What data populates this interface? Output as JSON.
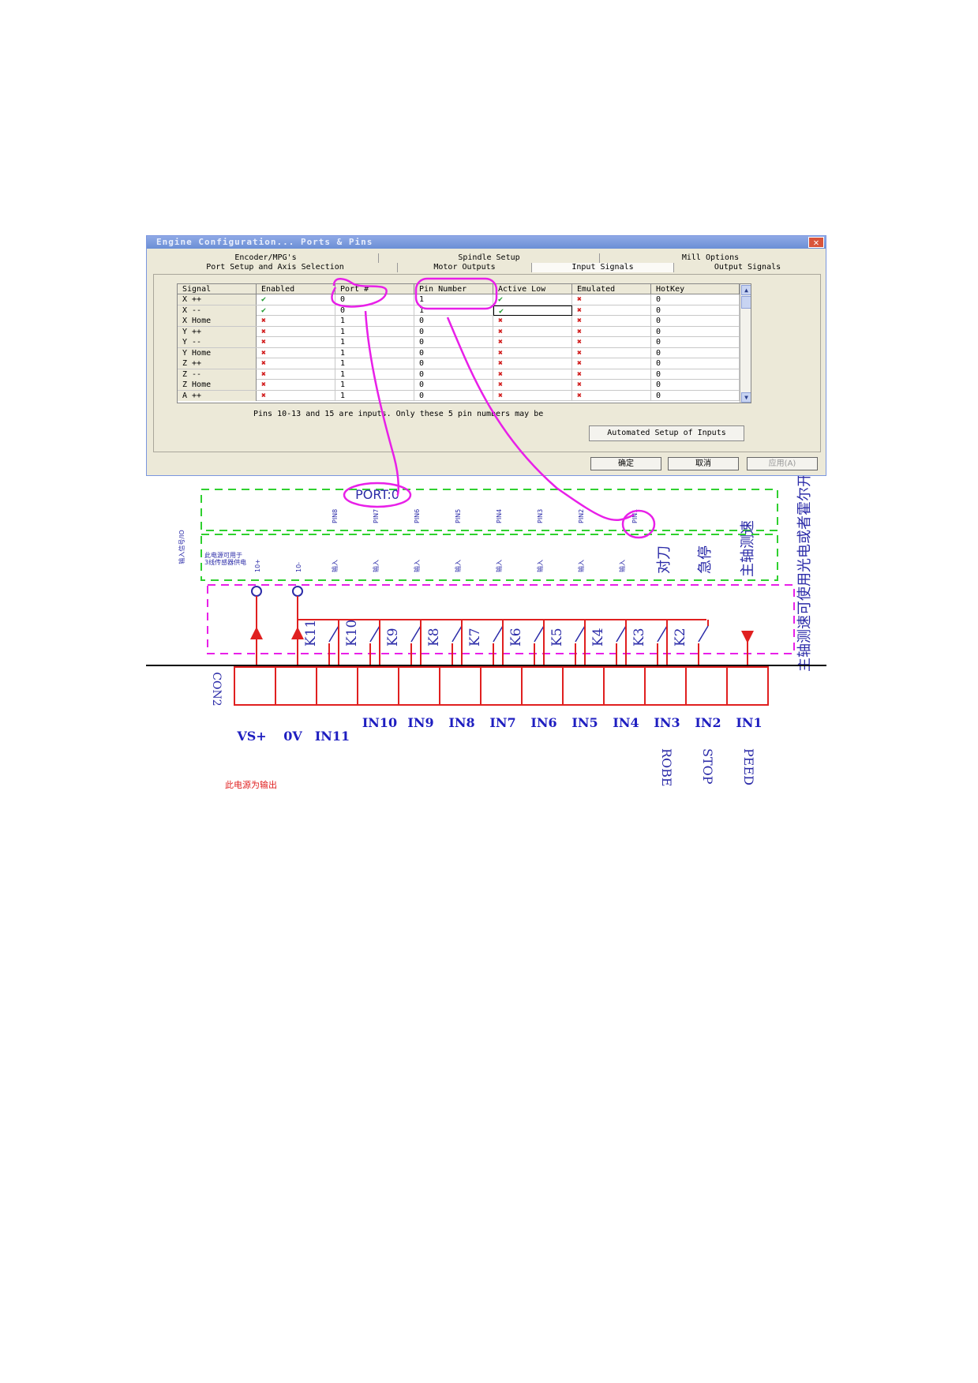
{
  "dialog": {
    "title": "Engine Configuration... Ports & Pins",
    "tabs_row1": [
      "Encoder/MPG's",
      "Spindle Setup",
      "Mill Options"
    ],
    "tabs_row2": [
      "Port Setup and Axis Selection",
      "Motor Outputs",
      "Input Signals",
      "Output Signals"
    ],
    "active_tab": "Input Signals",
    "columns": [
      "Signal",
      "Enabled",
      "Port #",
      "Pin Number",
      "Active Low",
      "Emulated",
      "HotKey"
    ],
    "rows": [
      {
        "signal": "X ++",
        "enabled": "check",
        "port": "0",
        "pin": "1",
        "active_low": "check",
        "emulated": "cross",
        "hotkey": "0"
      },
      {
        "signal": "X --",
        "enabled": "check",
        "port": "0",
        "pin": "1",
        "active_low": "check",
        "emulated": "cross",
        "hotkey": "0"
      },
      {
        "signal": "X Home",
        "enabled": "cross",
        "port": "1",
        "pin": "0",
        "active_low": "cross",
        "emulated": "cross",
        "hotkey": "0"
      },
      {
        "signal": "Y ++",
        "enabled": "cross",
        "port": "1",
        "pin": "0",
        "active_low": "cross",
        "emulated": "cross",
        "hotkey": "0"
      },
      {
        "signal": "Y --",
        "enabled": "cross",
        "port": "1",
        "pin": "0",
        "active_low": "cross",
        "emulated": "cross",
        "hotkey": "0"
      },
      {
        "signal": "Y Home",
        "enabled": "cross",
        "port": "1",
        "pin": "0",
        "active_low": "cross",
        "emulated": "cross",
        "hotkey": "0"
      },
      {
        "signal": "Z ++",
        "enabled": "cross",
        "port": "1",
        "pin": "0",
        "active_low": "cross",
        "emulated": "cross",
        "hotkey": "0"
      },
      {
        "signal": "Z --",
        "enabled": "cross",
        "port": "1",
        "pin": "0",
        "active_low": "cross",
        "emulated": "cross",
        "hotkey": "0"
      },
      {
        "signal": "Z Home",
        "enabled": "cross",
        "port": "1",
        "pin": "0",
        "active_low": "cross",
        "emulated": "cross",
        "hotkey": "0"
      },
      {
        "signal": "A ++",
        "enabled": "cross",
        "port": "1",
        "pin": "0",
        "active_low": "cross",
        "emulated": "cross",
        "hotkey": "0"
      }
    ],
    "hint": "Pins 10-13 and 15 are inputs. Only these 5 pin numbers may be",
    "auto_button": "Automated Setup of Inputs",
    "ok_button": "确定",
    "cancel_button": "取消",
    "apply_button": "应用(A)"
  },
  "circuit": {
    "port_label": "PORT:0",
    "pins": [
      "PIN8",
      "PIN7",
      "PIN6",
      "PIN5",
      "PIN4",
      "PIN3",
      "PIN2",
      "PIN1"
    ],
    "left_side_label": "输入信号/IO",
    "power_note": "此电源可用于\n3线传感器供电",
    "power_terms": [
      "10+",
      "10-"
    ],
    "input_word": "输入",
    "func_labels": [
      "对刀",
      "急停",
      "主轴测速"
    ],
    "right_note": "主轴测速可使用光电或者霍尔开关",
    "switches": [
      "K11",
      "K10",
      "K9",
      "K8",
      "K7",
      "K6",
      "K5",
      "K4",
      "K3",
      "K2"
    ],
    "connector": "CON2",
    "terminals": [
      "VS+",
      "0V",
      "IN11",
      "IN10",
      "IN9",
      "IN8",
      "IN7",
      "IN6",
      "IN5",
      "IN4",
      "IN3",
      "IN2",
      "IN1"
    ],
    "bottom_labels": [
      "ROBE",
      "STOP",
      "PEED"
    ],
    "output_note": "此电源为输出",
    "colors": {
      "magenta": "#e820e8",
      "green": "#2fd02f",
      "red": "#e02020",
      "blue": "#1e1ec0"
    }
  }
}
